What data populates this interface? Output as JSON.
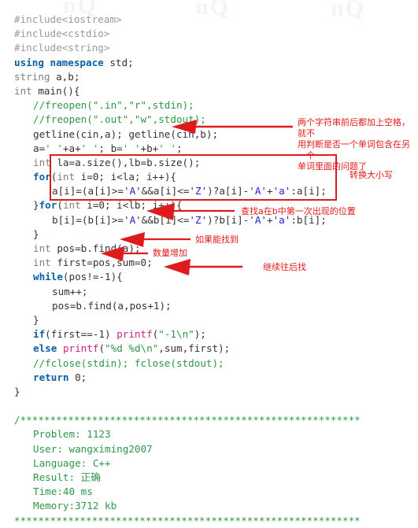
{
  "editor": {
    "language": "C++",
    "code_lines": [
      {
        "id": "l1",
        "indent": 0,
        "tokens": [
          {
            "t": "pp",
            "v": "#include<iostream>"
          }
        ]
      },
      {
        "id": "l2",
        "indent": 0,
        "tokens": [
          {
            "t": "pp",
            "v": "#include<cstdio>"
          }
        ]
      },
      {
        "id": "l3",
        "indent": 0,
        "tokens": [
          {
            "t": "pp",
            "v": "#include<string>"
          }
        ]
      },
      {
        "id": "l4",
        "indent": 0,
        "tokens": [
          {
            "t": "kw",
            "v": "using namespace"
          },
          {
            "t": "pl",
            "v": " std;"
          }
        ]
      },
      {
        "id": "l5",
        "indent": 0,
        "tokens": [
          {
            "t": "ty",
            "v": "string"
          },
          {
            "t": "pl",
            "v": " a,b;"
          }
        ]
      },
      {
        "id": "l6",
        "indent": 0,
        "tokens": [
          {
            "t": "ty",
            "v": "int"
          },
          {
            "t": "pl",
            "v": " main(){"
          }
        ]
      },
      {
        "id": "l7",
        "indent": 1,
        "tokens": [
          {
            "t": "cm",
            "v": "//freopen(\".in\",\"r\",stdin);"
          }
        ]
      },
      {
        "id": "l8",
        "indent": 1,
        "tokens": [
          {
            "t": "cm",
            "v": "//freopen(\".out\",\"w\",stdout);"
          }
        ]
      },
      {
        "id": "l9",
        "indent": 1,
        "tokens": [
          {
            "t": "pl",
            "v": "getline(cin,a); getline(cin,b);"
          }
        ]
      },
      {
        "id": "l10",
        "indent": 1,
        "tokens": [
          {
            "t": "pl",
            "v": "a="
          },
          {
            "t": "strl",
            "v": "' '"
          },
          {
            "t": "pl",
            "v": "+a+"
          },
          {
            "t": "strl",
            "v": "' '"
          },
          {
            "t": "pl",
            "v": "; b="
          },
          {
            "t": "strl",
            "v": "' '"
          },
          {
            "t": "pl",
            "v": "+b+"
          },
          {
            "t": "strl",
            "v": "' '"
          },
          {
            "t": "pl",
            "v": ";"
          }
        ]
      },
      {
        "id": "l11",
        "indent": 1,
        "tokens": [
          {
            "t": "ty",
            "v": "int"
          },
          {
            "t": "pl",
            "v": " la=a.size(),lb=b.size();"
          }
        ]
      },
      {
        "id": "l12",
        "indent": 1,
        "tokens": [
          {
            "t": "kw",
            "v": "for"
          },
          {
            "t": "pl",
            "v": "("
          },
          {
            "t": "ty",
            "v": "int"
          },
          {
            "t": "pl",
            "v": " i=0; i<la; i++){"
          }
        ]
      },
      {
        "id": "l13",
        "indent": 2,
        "tokens": [
          {
            "t": "pl",
            "v": "a[i]=(a[i]>="
          },
          {
            "t": "chr",
            "v": "'A'"
          },
          {
            "t": "pl",
            "v": "&&a[i]<="
          },
          {
            "t": "chr",
            "v": "'Z'"
          },
          {
            "t": "pl",
            "v": ")?a[i]-"
          },
          {
            "t": "chr",
            "v": "'A'"
          },
          {
            "t": "pl",
            "v": "+"
          },
          {
            "t": "chr",
            "v": "'a'"
          },
          {
            "t": "pl",
            "v": ":a[i];"
          }
        ]
      },
      {
        "id": "l14",
        "indent": 1,
        "tokens": [
          {
            "t": "pl",
            "v": "}"
          },
          {
            "t": "kw",
            "v": "for"
          },
          {
            "t": "pl",
            "v": "("
          },
          {
            "t": "ty",
            "v": "int"
          },
          {
            "t": "pl",
            "v": " i=0; i<lb; i++){"
          }
        ]
      },
      {
        "id": "l15",
        "indent": 2,
        "tokens": [
          {
            "t": "pl",
            "v": "b[i]=(b[i]>="
          },
          {
            "t": "chr",
            "v": "'A'"
          },
          {
            "t": "pl",
            "v": "&&b[i]<="
          },
          {
            "t": "chr",
            "v": "'Z'"
          },
          {
            "t": "pl",
            "v": ")?b[i]-"
          },
          {
            "t": "chr",
            "v": "'A'"
          },
          {
            "t": "pl",
            "v": "+"
          },
          {
            "t": "chr",
            "v": "'a'"
          },
          {
            "t": "pl",
            "v": ":b[i];"
          }
        ]
      },
      {
        "id": "l16",
        "indent": 1,
        "tokens": [
          {
            "t": "pl",
            "v": "}"
          }
        ]
      },
      {
        "id": "l17",
        "indent": 1,
        "tokens": [
          {
            "t": "ty",
            "v": "int"
          },
          {
            "t": "pl",
            "v": " pos=b.find(a);"
          }
        ]
      },
      {
        "id": "l18",
        "indent": 1,
        "tokens": [
          {
            "t": "ty",
            "v": "int"
          },
          {
            "t": "pl",
            "v": " first=pos,sum=0;"
          }
        ]
      },
      {
        "id": "l19",
        "indent": 1,
        "tokens": [
          {
            "t": "kw",
            "v": "while"
          },
          {
            "t": "pl",
            "v": "(pos!=-1){"
          }
        ]
      },
      {
        "id": "l20",
        "indent": 2,
        "tokens": [
          {
            "t": "pl",
            "v": "sum++;"
          }
        ]
      },
      {
        "id": "l21",
        "indent": 2,
        "tokens": [
          {
            "t": "pl",
            "v": "pos=b.find(a,pos+1);"
          }
        ]
      },
      {
        "id": "l22",
        "indent": 1,
        "tokens": [
          {
            "t": "pl",
            "v": "}"
          }
        ]
      },
      {
        "id": "l23",
        "indent": 1,
        "tokens": [
          {
            "t": "kw",
            "v": "if"
          },
          {
            "t": "pl",
            "v": "(first==-1) "
          },
          {
            "t": "st",
            "v": "printf"
          },
          {
            "t": "pl",
            "v": "("
          },
          {
            "t": "strl",
            "v": "\"-1\\n\""
          },
          {
            "t": "pl",
            "v": ");"
          }
        ]
      },
      {
        "id": "l24",
        "indent": 1,
        "tokens": [
          {
            "t": "kw",
            "v": "else"
          },
          {
            "t": "pl",
            "v": " "
          },
          {
            "t": "st",
            "v": "printf"
          },
          {
            "t": "pl",
            "v": "("
          },
          {
            "t": "strl",
            "v": "\"%d %d\\n\""
          },
          {
            "t": "pl",
            "v": ",sum,first);"
          }
        ]
      },
      {
        "id": "l25",
        "indent": 1,
        "tokens": [
          {
            "t": "cm",
            "v": "//fclose(stdin); fclose(stdout);"
          }
        ]
      },
      {
        "id": "l26",
        "indent": 1,
        "tokens": [
          {
            "t": "kw",
            "v": "return"
          },
          {
            "t": "pl",
            "v": " 0;"
          }
        ]
      },
      {
        "id": "l27",
        "indent": 0,
        "tokens": [
          {
            "t": "pl",
            "v": "}"
          }
        ]
      },
      {
        "id": "l28",
        "indent": 0,
        "tokens": [
          {
            "t": "pl",
            "v": ""
          }
        ]
      },
      {
        "id": "l29",
        "indent": 0,
        "tokens": [
          {
            "t": "cm",
            "v": "/*********************************************************"
          }
        ]
      },
      {
        "id": "l30",
        "indent": 1,
        "tokens": [
          {
            "t": "cm",
            "v": "Problem: 1123"
          }
        ]
      },
      {
        "id": "l31",
        "indent": 1,
        "tokens": [
          {
            "t": "cm",
            "v": "User: wangximing2007"
          }
        ]
      },
      {
        "id": "l32",
        "indent": 1,
        "tokens": [
          {
            "t": "cm",
            "v": "Language: C++"
          }
        ]
      },
      {
        "id": "l33",
        "indent": 1,
        "tokens": [
          {
            "t": "cm",
            "v": "Result: 正确"
          }
        ]
      },
      {
        "id": "l34",
        "indent": 1,
        "tokens": [
          {
            "t": "cm",
            "v": "Time:40 ms"
          }
        ]
      },
      {
        "id": "l35",
        "indent": 1,
        "tokens": [
          {
            "t": "cm",
            "v": "Memory:3712 kb"
          }
        ]
      },
      {
        "id": "l36",
        "indent": 0,
        "tokens": [
          {
            "t": "cm",
            "v": "**********************************************************"
          }
        ]
      }
    ]
  },
  "submission": {
    "problem_label": "Problem:",
    "problem_id": "1123",
    "user_label": "User:",
    "user_name": "wangximing2007",
    "language_label": "Language:",
    "language_value": "C++",
    "result_label": "Result:",
    "result_value": "正确",
    "time_label": "Time:",
    "time_value": "40 ms",
    "memory_label": "Memory:",
    "memory_value": "3712 kb"
  },
  "annotations": {
    "accent_color": "#e01b1b",
    "notes": [
      {
        "id": "note-padding",
        "text": "两个字符串前后都加上空格，就不\n用判断是否一个单词包含在另一个\n单词里面的问题了"
      },
      {
        "id": "note-case",
        "text": "转换大小写"
      },
      {
        "id": "note-find-first",
        "text": "查找a在b中第一次出现的位置"
      },
      {
        "id": "note-if-found",
        "text": "如果能找到"
      },
      {
        "id": "note-count-increase",
        "text": "数量增加"
      },
      {
        "id": "note-keep-searching",
        "text": "继续往后找"
      }
    ]
  },
  "watermark": {
    "text_a": "nQ",
    "text_b": "nQ",
    "text_c": "nQ"
  }
}
